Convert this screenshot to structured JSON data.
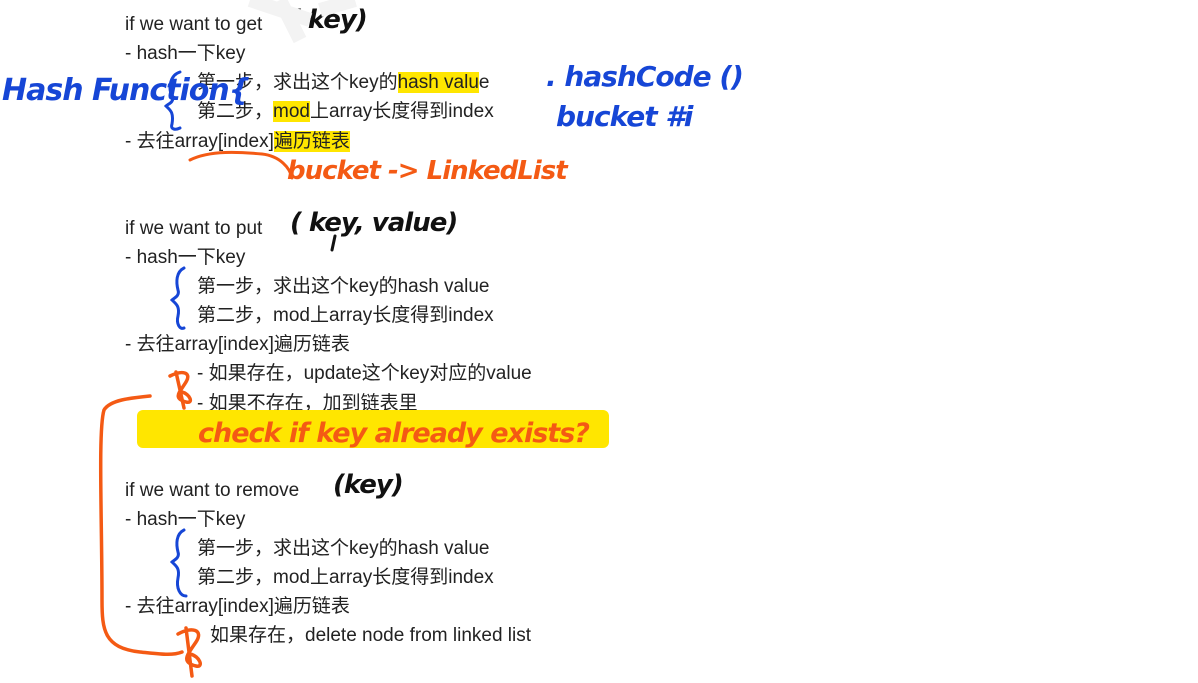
{
  "get_section": {
    "heading": "if we want to get",
    "handwritten_arg": "( key)",
    "step_hash": "- hash一下key",
    "step1_before": "第一步，求出这个key的",
    "step1_highlight": "hash valu",
    "step1_after": "e",
    "step2_highlight": "mod",
    "step2_text": "上array长度得到index",
    "step2_prefix": "第二步，",
    "step3_before": "- 去往array[index]",
    "step3_highlight": "遍历链表",
    "note_hash_function": "Hash Function{",
    "note_hashcode": ". hashCode ()",
    "note_bucket_i": "bucket #i",
    "note_bucket_linked": "bucket -> LinkedList"
  },
  "put_section": {
    "heading": "if we want to put",
    "handwritten_arg": "( key, value)",
    "step_hash": "- hash一下key",
    "step1": "第一步，求出这个key的hash value",
    "step2": "第二步，mod上array长度得到index",
    "step3": "- 去往array[index]遍历链表",
    "sub1": "- 如果存在，update这个key对应的value",
    "sub2": "- 如果不存在，加到链表里",
    "note_check": "check if key already exists?"
  },
  "remove_section": {
    "heading": "if we want to remove",
    "handwritten_arg": "(key)",
    "step_hash": "- hash一下key",
    "step1": "第一步，求出这个key的hash value",
    "step2": "第二步，mod上array长度得到index",
    "step3": "- 去往array[index]遍历链表",
    "sub1": "如果存在，delete node from linked list"
  },
  "colors": {
    "highlight": "#ffe600",
    "ink_blue": "#1646d6",
    "ink_orange": "#f45a14",
    "ink_black": "#111111"
  }
}
